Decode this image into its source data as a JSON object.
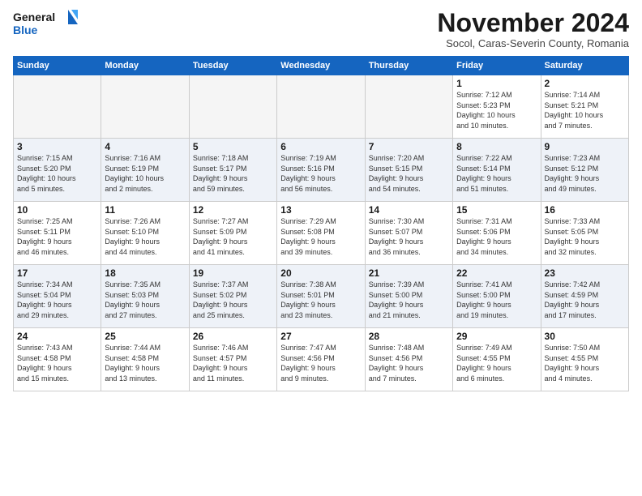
{
  "logo": {
    "line1": "General",
    "line2": "Blue"
  },
  "title": "November 2024",
  "subtitle": "Socol, Caras-Severin County, Romania",
  "weekdays": [
    "Sunday",
    "Monday",
    "Tuesday",
    "Wednesday",
    "Thursday",
    "Friday",
    "Saturday"
  ],
  "weeks": [
    [
      {
        "day": "",
        "info": ""
      },
      {
        "day": "",
        "info": ""
      },
      {
        "day": "",
        "info": ""
      },
      {
        "day": "",
        "info": ""
      },
      {
        "day": "",
        "info": ""
      },
      {
        "day": "1",
        "info": "Sunrise: 7:12 AM\nSunset: 5:23 PM\nDaylight: 10 hours\nand 10 minutes."
      },
      {
        "day": "2",
        "info": "Sunrise: 7:14 AM\nSunset: 5:21 PM\nDaylight: 10 hours\nand 7 minutes."
      }
    ],
    [
      {
        "day": "3",
        "info": "Sunrise: 7:15 AM\nSunset: 5:20 PM\nDaylight: 10 hours\nand 5 minutes."
      },
      {
        "day": "4",
        "info": "Sunrise: 7:16 AM\nSunset: 5:19 PM\nDaylight: 10 hours\nand 2 minutes."
      },
      {
        "day": "5",
        "info": "Sunrise: 7:18 AM\nSunset: 5:17 PM\nDaylight: 9 hours\nand 59 minutes."
      },
      {
        "day": "6",
        "info": "Sunrise: 7:19 AM\nSunset: 5:16 PM\nDaylight: 9 hours\nand 56 minutes."
      },
      {
        "day": "7",
        "info": "Sunrise: 7:20 AM\nSunset: 5:15 PM\nDaylight: 9 hours\nand 54 minutes."
      },
      {
        "day": "8",
        "info": "Sunrise: 7:22 AM\nSunset: 5:14 PM\nDaylight: 9 hours\nand 51 minutes."
      },
      {
        "day": "9",
        "info": "Sunrise: 7:23 AM\nSunset: 5:12 PM\nDaylight: 9 hours\nand 49 minutes."
      }
    ],
    [
      {
        "day": "10",
        "info": "Sunrise: 7:25 AM\nSunset: 5:11 PM\nDaylight: 9 hours\nand 46 minutes."
      },
      {
        "day": "11",
        "info": "Sunrise: 7:26 AM\nSunset: 5:10 PM\nDaylight: 9 hours\nand 44 minutes."
      },
      {
        "day": "12",
        "info": "Sunrise: 7:27 AM\nSunset: 5:09 PM\nDaylight: 9 hours\nand 41 minutes."
      },
      {
        "day": "13",
        "info": "Sunrise: 7:29 AM\nSunset: 5:08 PM\nDaylight: 9 hours\nand 39 minutes."
      },
      {
        "day": "14",
        "info": "Sunrise: 7:30 AM\nSunset: 5:07 PM\nDaylight: 9 hours\nand 36 minutes."
      },
      {
        "day": "15",
        "info": "Sunrise: 7:31 AM\nSunset: 5:06 PM\nDaylight: 9 hours\nand 34 minutes."
      },
      {
        "day": "16",
        "info": "Sunrise: 7:33 AM\nSunset: 5:05 PM\nDaylight: 9 hours\nand 32 minutes."
      }
    ],
    [
      {
        "day": "17",
        "info": "Sunrise: 7:34 AM\nSunset: 5:04 PM\nDaylight: 9 hours\nand 29 minutes."
      },
      {
        "day": "18",
        "info": "Sunrise: 7:35 AM\nSunset: 5:03 PM\nDaylight: 9 hours\nand 27 minutes."
      },
      {
        "day": "19",
        "info": "Sunrise: 7:37 AM\nSunset: 5:02 PM\nDaylight: 9 hours\nand 25 minutes."
      },
      {
        "day": "20",
        "info": "Sunrise: 7:38 AM\nSunset: 5:01 PM\nDaylight: 9 hours\nand 23 minutes."
      },
      {
        "day": "21",
        "info": "Sunrise: 7:39 AM\nSunset: 5:00 PM\nDaylight: 9 hours\nand 21 minutes."
      },
      {
        "day": "22",
        "info": "Sunrise: 7:41 AM\nSunset: 5:00 PM\nDaylight: 9 hours\nand 19 minutes."
      },
      {
        "day": "23",
        "info": "Sunrise: 7:42 AM\nSunset: 4:59 PM\nDaylight: 9 hours\nand 17 minutes."
      }
    ],
    [
      {
        "day": "24",
        "info": "Sunrise: 7:43 AM\nSunset: 4:58 PM\nDaylight: 9 hours\nand 15 minutes."
      },
      {
        "day": "25",
        "info": "Sunrise: 7:44 AM\nSunset: 4:58 PM\nDaylight: 9 hours\nand 13 minutes."
      },
      {
        "day": "26",
        "info": "Sunrise: 7:46 AM\nSunset: 4:57 PM\nDaylight: 9 hours\nand 11 minutes."
      },
      {
        "day": "27",
        "info": "Sunrise: 7:47 AM\nSunset: 4:56 PM\nDaylight: 9 hours\nand 9 minutes."
      },
      {
        "day": "28",
        "info": "Sunrise: 7:48 AM\nSunset: 4:56 PM\nDaylight: 9 hours\nand 7 minutes."
      },
      {
        "day": "29",
        "info": "Sunrise: 7:49 AM\nSunset: 4:55 PM\nDaylight: 9 hours\nand 6 minutes."
      },
      {
        "day": "30",
        "info": "Sunrise: 7:50 AM\nSunset: 4:55 PM\nDaylight: 9 hours\nand 4 minutes."
      }
    ]
  ]
}
